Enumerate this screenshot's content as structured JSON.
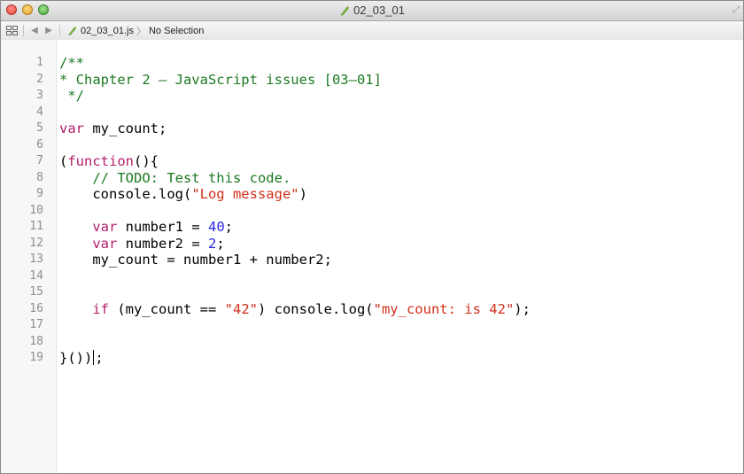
{
  "window": {
    "title": "02_03_01",
    "file_icon": "js-file-icon"
  },
  "jumpbar": {
    "grid_icon": "related-files-grid-icon",
    "back_icon": "back-arrow-icon",
    "forward_icon": "forward-arrow-icon",
    "file_name": "02_03_01.js",
    "chevron": "〉",
    "selection": "No Selection"
  },
  "colors": {
    "comment": "#1c7a22",
    "keyword": "#b3206b",
    "string": "#d12f1b",
    "number": "#2a2ae0"
  },
  "code": {
    "lines": [
      {
        "n": "1",
        "tokens": [
          {
            "t": "comment",
            "v": "/**"
          }
        ]
      },
      {
        "n": "2",
        "tokens": [
          {
            "t": "comment",
            "v": "* Chapter 2 – JavaScript issues [03–01]"
          }
        ]
      },
      {
        "n": "3",
        "tokens": [
          {
            "t": "comment",
            "v": " */"
          }
        ]
      },
      {
        "n": "4",
        "tokens": []
      },
      {
        "n": "5",
        "tokens": [
          {
            "t": "keyword",
            "v": "var"
          },
          {
            "t": "plain",
            "v": " my_count;"
          }
        ]
      },
      {
        "n": "6",
        "tokens": []
      },
      {
        "n": "7",
        "tokens": [
          {
            "t": "plain",
            "v": "("
          },
          {
            "t": "keyword",
            "v": "function"
          },
          {
            "t": "plain",
            "v": "(){"
          }
        ]
      },
      {
        "n": "8",
        "tokens": [
          {
            "t": "comment",
            "v": "    // TODO: Test this code."
          }
        ]
      },
      {
        "n": "9",
        "tokens": [
          {
            "t": "plain",
            "v": "    console.log("
          },
          {
            "t": "string",
            "v": "\"Log message\""
          },
          {
            "t": "plain",
            "v": ")"
          }
        ]
      },
      {
        "n": "10",
        "tokens": []
      },
      {
        "n": "11",
        "tokens": [
          {
            "t": "plain",
            "v": "    "
          },
          {
            "t": "keyword",
            "v": "var"
          },
          {
            "t": "plain",
            "v": " number1 = "
          },
          {
            "t": "number",
            "v": "40"
          },
          {
            "t": "plain",
            "v": ";"
          }
        ]
      },
      {
        "n": "12",
        "tokens": [
          {
            "t": "plain",
            "v": "    "
          },
          {
            "t": "keyword",
            "v": "var"
          },
          {
            "t": "plain",
            "v": " number2 = "
          },
          {
            "t": "number",
            "v": "2"
          },
          {
            "t": "plain",
            "v": ";"
          }
        ]
      },
      {
        "n": "13",
        "tokens": [
          {
            "t": "plain",
            "v": "    my_count = number1 + number2;"
          }
        ]
      },
      {
        "n": "14",
        "tokens": []
      },
      {
        "n": "15",
        "tokens": []
      },
      {
        "n": "16",
        "tokens": [
          {
            "t": "plain",
            "v": "    "
          },
          {
            "t": "keyword",
            "v": "if"
          },
          {
            "t": "plain",
            "v": " (my_count == "
          },
          {
            "t": "string",
            "v": "\"42\""
          },
          {
            "t": "plain",
            "v": ") console.log("
          },
          {
            "t": "string",
            "v": "\"my_count: is 42\""
          },
          {
            "t": "plain",
            "v": ");"
          }
        ]
      },
      {
        "n": "17",
        "tokens": []
      },
      {
        "n": "18",
        "tokens": []
      },
      {
        "n": "19",
        "tokens": [
          {
            "t": "plain",
            "v": "}())"
          },
          {
            "t": "caret",
            "v": ""
          },
          {
            "t": "plain",
            "v": ";"
          }
        ]
      }
    ]
  }
}
